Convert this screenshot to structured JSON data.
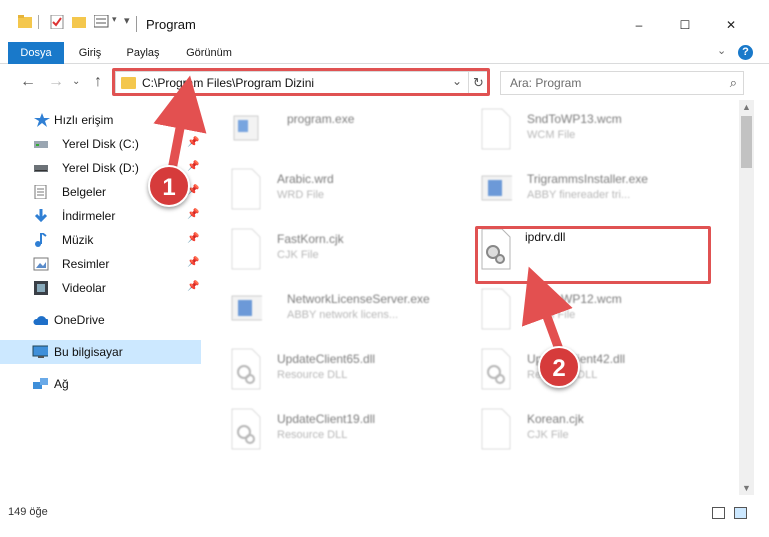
{
  "window": {
    "title": "Program",
    "minimize": "–",
    "maximize": "☐",
    "close": "✕"
  },
  "ribbon": {
    "tabs": [
      "Dosya",
      "Giriş",
      "Paylaş",
      "Görünüm"
    ],
    "help": "?"
  },
  "address": {
    "path": "C:\\Program Files\\Program Dizini",
    "search_placeholder": "Ara: Program"
  },
  "sidebar": {
    "quick_access": "Hızlı erişim",
    "items": [
      {
        "label": "Yerel Disk (C:)",
        "icon": "drive-icon"
      },
      {
        "label": "Yerel Disk (D:)",
        "icon": "drive-icon"
      },
      {
        "label": "Belgeler",
        "icon": "documents-icon"
      },
      {
        "label": "İndirmeler",
        "icon": "download-icon"
      },
      {
        "label": "Müzik",
        "icon": "music-icon"
      },
      {
        "label": "Resimler",
        "icon": "pictures-icon"
      },
      {
        "label": "Videolar",
        "icon": "video-icon"
      }
    ],
    "onedrive": "OneDrive",
    "this_pc": "Bu bilgisayar",
    "network": "Ağ"
  },
  "files": {
    "left": [
      {
        "name": "program.exe",
        "type": ""
      },
      {
        "name": "Arabic.wrd",
        "type": "WRD File"
      },
      {
        "name": "FastKorn.cjk",
        "type": "CJK File"
      },
      {
        "name": "NetworkLicenseServer.exe",
        "type": "ABBY network licens..."
      },
      {
        "name": "UpdateClient65.dll",
        "type": "Resource DLL"
      },
      {
        "name": "UpdateClient19.dll",
        "type": "Resource DLL"
      }
    ],
    "right": [
      {
        "name": "SndToWP13.wcm",
        "type": "WCM File"
      },
      {
        "name": "TrigrammsInstaller.exe",
        "type": "ABBY finereader tri..."
      },
      {
        "name": "ipdrv.dll",
        "type": ""
      },
      {
        "name": "SndToWP12.wcm",
        "type": "WCM File"
      },
      {
        "name": "UpdateClient42.dll",
        "type": "Resource DLL"
      },
      {
        "name": "Korean.cjk",
        "type": "CJK File"
      }
    ]
  },
  "status": {
    "item_count": "149 öğe"
  },
  "callouts": {
    "one": "1",
    "two": "2"
  },
  "colors": {
    "accent": "#1979ca",
    "highlight": "#e05252"
  }
}
